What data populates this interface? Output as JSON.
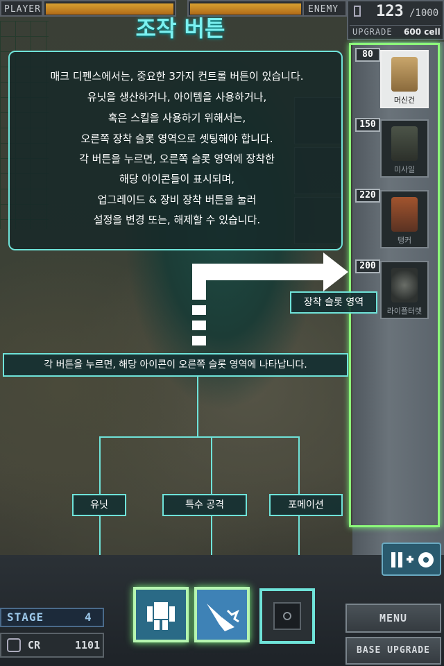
{
  "hud": {
    "player_label": "PLAYER",
    "enemy_label": "ENEMY",
    "cell_count": "123",
    "cell_max": "/1000",
    "upgrade_label": "UPGRADE",
    "upgrade_cost": "600 cell"
  },
  "tutorial": {
    "title": "조작 버튼",
    "lines": [
      "매크 디펜스에서는, 중요한 3가지 컨트롤 버튼이 있습니다.",
      "유닛을 생산하거나, 아이템을 사용하거나,",
      "혹은 스킬을 사용하기  위해서는,",
      "오른쪽 장착 슬롯 영역으로 셋팅해야 합니다.",
      "각 버튼을 누르면, 오른쪽 슬롯 영역에 장착한",
      "해당 아이콘들이 표시되며,",
      "업그레이드 & 장비 장착 버튼을 눌러",
      "설정을 변경 또는, 해제할 수 있습니다."
    ],
    "slot_area_label": "장착 슬롯 영역",
    "button_caption": "각 버튼을 누르면, 해당 아이콘이 오른쪽 슬롯 영역에 나타납니다.",
    "unit_label": "유닛",
    "special_label": "특수 공격",
    "formation_label": "포메이션"
  },
  "slots": [
    {
      "cost": "80",
      "name": "머신건",
      "active": true
    },
    {
      "cost": "150",
      "name": "미사일",
      "active": false
    },
    {
      "cost": "220",
      "name": "탱커",
      "active": false
    },
    {
      "cost": "200",
      "name": "라이플터렛",
      "active": false
    }
  ],
  "bottom": {
    "stage_label": "STAGE",
    "stage_value": "4",
    "cr_label": "CR",
    "cr_value": "1101",
    "menu_label": "MENU",
    "base_upgrade_label": "BASE UPGRADE"
  },
  "colors": {
    "accent": "#6fe3d9",
    "slot_highlight": "#8cf77a",
    "title": "#7af0f0"
  }
}
